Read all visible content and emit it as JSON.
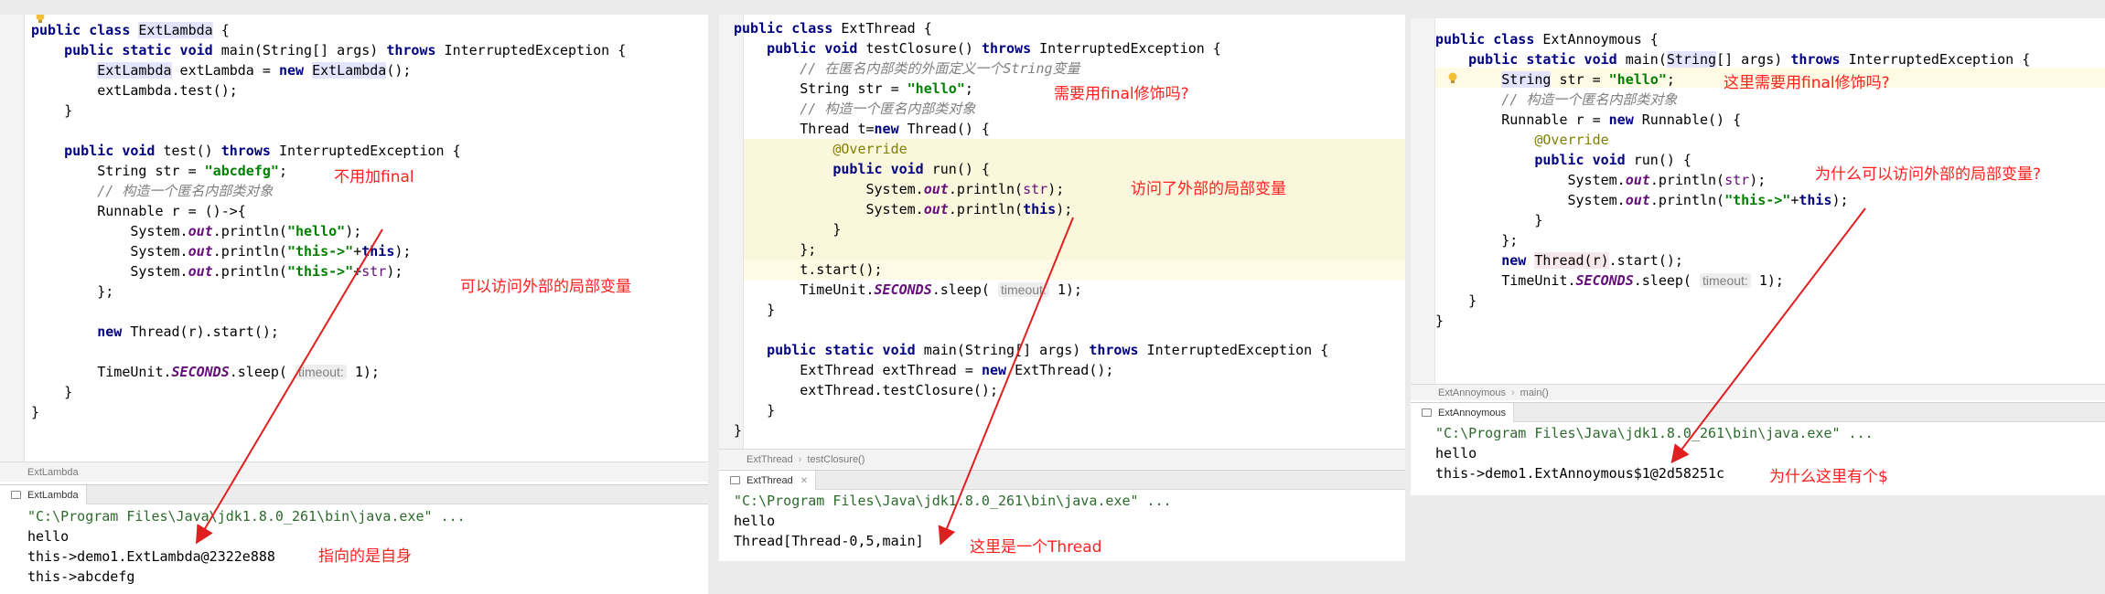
{
  "panel1": {
    "code": [
      "public class ExtLambda {",
      "    public static void main(String[] args) throws InterruptedException {",
      "        ExtLambda extLambda = new ExtLambda();",
      "        extLambda.test();",
      "    }",
      "",
      "    public void test() throws InterruptedException {",
      "        String str = \"abcdefg\";",
      "        // 构造一个匿名内部类对象",
      "        Runnable r = ()->{",
      "            System.out.println(\"hello\");",
      "            System.out.println(\"this->\"+this);",
      "            System.out.println(\"this->\"+str);",
      "        };",
      "",
      "        new Thread(r).start();",
      "",
      "        TimeUnit.SECONDS.sleep( timeout: 1);",
      "    }",
      "}"
    ],
    "breadcrumb": [
      "ExtLambda"
    ],
    "run_tab": "ExtLambda",
    "console": [
      "\"C:\\Program Files\\Java\\jdk1.8.0_261\\bin\\java.exe\" ...",
      "hello",
      "this->demo1.ExtLambda@2322e888",
      "this->abcdefg"
    ],
    "notes": {
      "no_final": "不用加final",
      "can_access": "可以访问外部的局部变量",
      "points_to_self": "指向的是自身"
    }
  },
  "panel2": {
    "code": [
      "public class ExtThread {",
      "    public void testClosure() throws InterruptedException {",
      "        // 在匿名内部类的外面定义一个String变量",
      "        String str = \"hello\";",
      "        // 构造一个匿名内部类对象",
      "        Thread t=new Thread() {",
      "            @Override",
      "            public void run() {",
      "                System.out.println(str);",
      "                System.out.println(this);",
      "            }",
      "        };",
      "        t.start();",
      "        TimeUnit.SECONDS.sleep( timeout: 1);",
      "    }",
      "",
      "    public static void main(String[] args) throws InterruptedException {",
      "        ExtThread extThread = new ExtThread();",
      "        extThread.testClosure();",
      "    }",
      "}"
    ],
    "breadcrumb": [
      "ExtThread",
      "testClosure()"
    ],
    "run_tab": "ExtThread",
    "console": [
      "\"C:\\Program Files\\Java\\jdk1.8.0_261\\bin\\java.exe\" ...",
      "hello",
      "Thread[Thread-0,5,main]"
    ],
    "notes": {
      "need_final": "需要用final修饰吗?",
      "accessed_local": "访问了外部的局部变量",
      "is_thread": "这里是一个Thread"
    }
  },
  "panel3": {
    "code": [
      "public class ExtAnnoymous {",
      "    public static void main(String[] args) throws InterruptedException {",
      "        String str = \"hello\";",
      "        // 构造一个匿名内部类对象",
      "        Runnable r = new Runnable() {",
      "            @Override",
      "            public void run() {",
      "                System.out.println(str);",
      "                System.out.println(\"this->\"+this);",
      "            }",
      "        };",
      "        new Thread(r).start();",
      "        TimeUnit.SECONDS.sleep( timeout: 1);",
      "    }",
      "}"
    ],
    "breadcrumb": [
      "ExtAnnoymous",
      "main()"
    ],
    "run_tab": "ExtAnnoymous",
    "console": [
      "\"C:\\Program Files\\Java\\jdk1.8.0_261\\bin\\java.exe\" ...",
      "hello",
      "this->demo1.ExtAnnoymous$1@2d58251c"
    ],
    "notes": {
      "need_final_here": "这里需要用final修饰吗?",
      "why_access": "为什么可以访问外部的局部变量?",
      "why_dollar": "为什么这里有个$"
    }
  },
  "colors": {
    "annotation_red": "#ff2020",
    "keyword": "#000080",
    "string": "#008000",
    "comment": "#808080",
    "highlight_block": "#fbf7dc"
  },
  "icons": [
    "bulb-icon",
    "run-console-icon",
    "close-icon",
    "fold-marker-icon"
  ]
}
